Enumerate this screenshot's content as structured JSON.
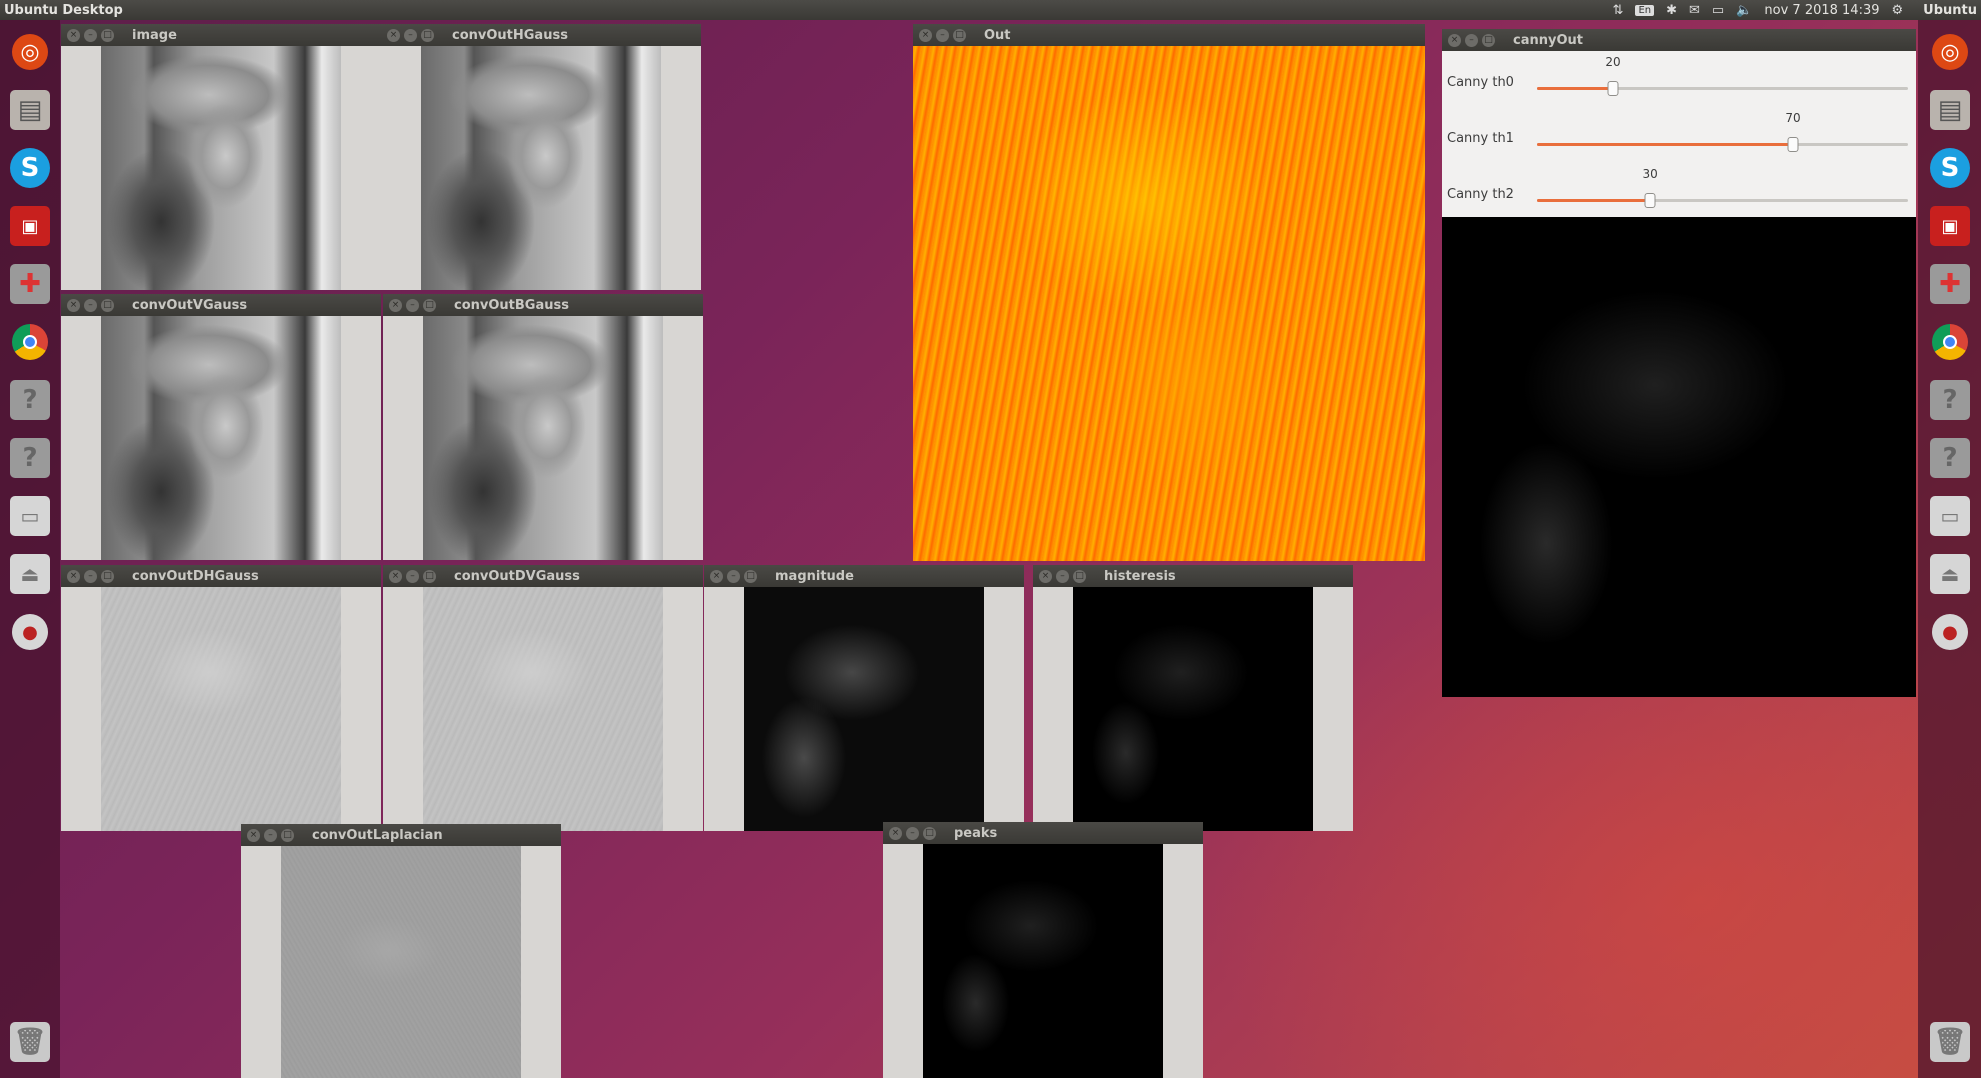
{
  "topbar": {
    "title": "Ubuntu Desktop",
    "lang": "En",
    "datetime": "nov 7 2018 14:39",
    "user": "Ubuntu"
  },
  "launcher": {
    "left_apps": [
      "ubuntu-dash",
      "files",
      "skype",
      "terminal-app",
      "settings",
      "chrome",
      "unknown-app",
      "unknown-app",
      "disk-drive",
      "usb-drive",
      "optical-disc",
      "trash"
    ],
    "right_apps": [
      "ubuntu-dash",
      "files",
      "skype",
      "terminal-app",
      "settings",
      "chrome",
      "unknown-app",
      "unknown-app",
      "disk-drive",
      "usb-drive",
      "optical-disc",
      "trash"
    ]
  },
  "windows": {
    "image": {
      "title": "image"
    },
    "hgauss": {
      "title": "convOutHGauss"
    },
    "vgauss": {
      "title": "convOutVGauss"
    },
    "bgauss": {
      "title": "convOutBGauss"
    },
    "dhgauss": {
      "title": "convOutDHGauss"
    },
    "dvgauss": {
      "title": "convOutDVGauss"
    },
    "magnitude": {
      "title": "magnitude"
    },
    "histeresis": {
      "title": "histeresis"
    },
    "laplacian": {
      "title": "convOutLaplacian"
    },
    "peaks": {
      "title": "peaks"
    },
    "out": {
      "title": "Out"
    },
    "canny": {
      "title": "cannyOut"
    }
  },
  "canny_sliders": [
    {
      "label": "Canny th0",
      "value": "20",
      "fraction": 0.205
    },
    {
      "label": "Canny th1",
      "value": "70",
      "fraction": 0.69
    },
    {
      "label": "Canny th2",
      "value": "30",
      "fraction": 0.305
    }
  ]
}
